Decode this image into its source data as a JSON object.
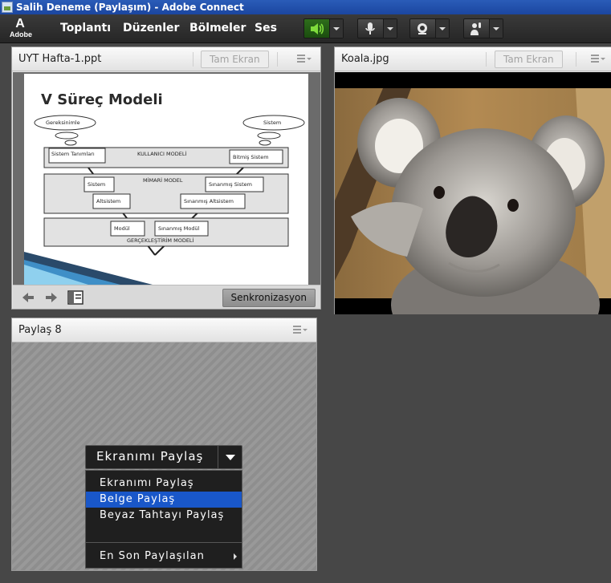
{
  "window": {
    "title": "Salih Deneme (Paylaşım) - Adobe Connect",
    "app_icon": "adobe-connect-icon"
  },
  "menubar": {
    "logo_mark": "A",
    "logo_word": "Adobe",
    "items": [
      "Toplantı",
      "Düzenler",
      "Bölmeler",
      "Ses"
    ],
    "buttons": [
      {
        "icon": "speaker-icon",
        "active": true
      },
      {
        "icon": "microphone-icon",
        "active": false
      },
      {
        "icon": "webcam-icon",
        "active": false
      },
      {
        "icon": "raise-hand-icon",
        "active": false
      }
    ]
  },
  "presentation_pod": {
    "title": "UYT Hafta-1.ppt",
    "fullscreen_label": "Tam Ekran",
    "sync_label": "Senkronizasyon",
    "slide": {
      "title": "V Süreç Modeli",
      "labels": {
        "requirements": "Gereksinimle",
        "system_top": "Sistem",
        "user_model": "KULLANICI MODELİ",
        "system_defs": "Sistem Tanımları",
        "finished_system": "Bitmiş Sistem",
        "arch_model": "MİMARİ MODEL",
        "arch_system": "Sistem",
        "tested_system": "Sınanmış Sistem",
        "subsystem": "Altsistem",
        "tested_subsystem": "Sınanmış Altsistem",
        "module": "Modül",
        "tested_module": "Sınanmış Modül",
        "impl_model": "GERÇEKLEŞTİRİM MODELİ"
      }
    }
  },
  "image_pod": {
    "title": "Koala.jpg",
    "fullscreen_label": "Tam Ekran"
  },
  "share_pod": {
    "title": "Paylaş 8",
    "button_label": "Ekranımı Paylaş",
    "menu": {
      "items": [
        {
          "label": "Ekranımı Paylaş",
          "selected": false
        },
        {
          "label": "Belge Paylaş",
          "selected": true
        },
        {
          "label": "Beyaz Tahtayı Paylaş",
          "selected": false
        }
      ],
      "recent_label": "En Son Paylaşılan"
    }
  },
  "colors": {
    "speaker_active": "#7fdc3c",
    "menu_selected": "#1957c9"
  }
}
